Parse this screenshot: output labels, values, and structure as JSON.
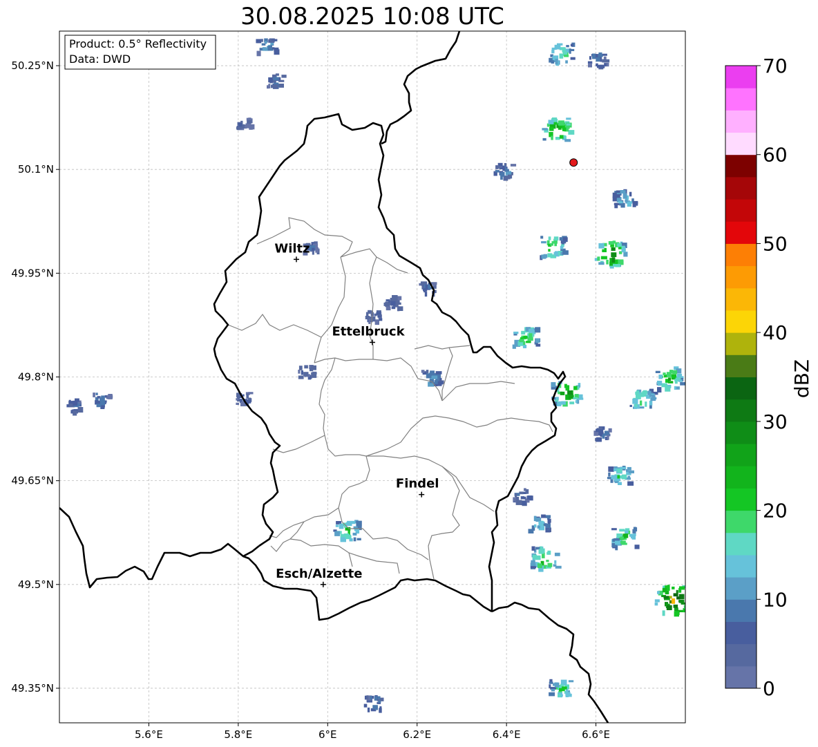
{
  "title": "30.08.2025 10:08 UTC",
  "info_box": {
    "line1": "Product: 0.5° Reflectivity",
    "line2": "Data: DWD"
  },
  "axes": {
    "x_ticks": [
      {
        "value": 5.6,
        "label": "5.6°E"
      },
      {
        "value": 5.8,
        "label": "5.8°E"
      },
      {
        "value": 6.0,
        "label": "6°E"
      },
      {
        "value": 6.2,
        "label": "6.2°E"
      },
      {
        "value": 6.4,
        "label": "6.4°E"
      },
      {
        "value": 6.6,
        "label": "6.6°E"
      }
    ],
    "y_ticks": [
      {
        "value": 50.25,
        "label": "50.25°N"
      },
      {
        "value": 50.1,
        "label": "50.1°N"
      },
      {
        "value": 49.95,
        "label": "49.95°N"
      },
      {
        "value": 49.8,
        "label": "49.8°N"
      },
      {
        "value": 49.65,
        "label": "49.65°N"
      },
      {
        "value": 49.5,
        "label": "49.5°N"
      },
      {
        "value": 49.35,
        "label": "49.35°N"
      }
    ],
    "lon_range": [
      5.4,
      6.8
    ],
    "lat_range": [
      49.3,
      50.3
    ],
    "grid": true
  },
  "cities": [
    {
      "name": "Wiltz",
      "lon": 5.93,
      "lat": 49.97
    },
    {
      "name": "Ettelbruck",
      "lon": 6.1,
      "lat": 49.85
    },
    {
      "name": "Findel",
      "lon": 6.21,
      "lat": 49.63
    },
    {
      "name": "Esch/Alzette",
      "lon": 5.99,
      "lat": 49.5
    }
  ],
  "radar_site": {
    "lon": 6.55,
    "lat": 50.11,
    "color": "#e31a1c"
  },
  "colorbar": {
    "label": "dBZ",
    "min": 0,
    "max": 70,
    "step": 2.5,
    "tick_labels": [
      "0",
      "10",
      "20",
      "30",
      "40",
      "50",
      "60",
      "70"
    ],
    "colors": [
      "#6674a8",
      "#56699f",
      "#485e9e",
      "#4a78ad",
      "#5b9fc7",
      "#66c2da",
      "#5fd8c4",
      "#3ed86a",
      "#14c624",
      "#12b41c",
      "#11a319",
      "#0f8d17",
      "#0e7a14",
      "#0b6512",
      "#4a7b16",
      "#afb30c",
      "#fcd506",
      "#fbb706",
      "#fd9b04",
      "#fd7f05",
      "#e3060a",
      "#c30608",
      "#a50608",
      "#7d0100",
      "#ffdbff",
      "#ffb0ff",
      "#ff73ff",
      "#eb3ef0"
    ]
  },
  "chart_data": {
    "type": "heatmap",
    "title": "30.08.2025 10:08 UTC",
    "colorbar_label": "dBZ",
    "value_range": [
      0,
      70
    ],
    "echo_cells": [
      {
        "lon": 5.43,
        "lat": 49.76,
        "dbz": 8
      },
      {
        "lon": 5.49,
        "lat": 49.77,
        "dbz": 10
      },
      {
        "lon": 5.81,
        "lat": 50.17,
        "dbz": 5
      },
      {
        "lon": 5.86,
        "lat": 50.28,
        "dbz": 12
      },
      {
        "lon": 5.88,
        "lat": 50.23,
        "dbz": 8
      },
      {
        "lon": 5.96,
        "lat": 49.99,
        "dbz": 5
      },
      {
        "lon": 5.95,
        "lat": 49.81,
        "dbz": 6
      },
      {
        "lon": 5.81,
        "lat": 49.77,
        "dbz": 6
      },
      {
        "lon": 6.1,
        "lat": 49.89,
        "dbz": 6
      },
      {
        "lon": 6.14,
        "lat": 49.91,
        "dbz": 6
      },
      {
        "lon": 6.04,
        "lat": 49.58,
        "dbz": 22
      },
      {
        "lon": 6.1,
        "lat": 49.33,
        "dbz": 10
      },
      {
        "lon": 6.22,
        "lat": 49.93,
        "dbz": 6
      },
      {
        "lon": 6.23,
        "lat": 49.8,
        "dbz": 12
      },
      {
        "lon": 6.52,
        "lat": 50.27,
        "dbz": 20
      },
      {
        "lon": 6.6,
        "lat": 50.26,
        "dbz": 10
      },
      {
        "lon": 6.51,
        "lat": 50.16,
        "dbz": 28
      },
      {
        "lon": 6.39,
        "lat": 50.1,
        "dbz": 10
      },
      {
        "lon": 6.66,
        "lat": 50.06,
        "dbz": 15
      },
      {
        "lon": 6.5,
        "lat": 49.99,
        "dbz": 22
      },
      {
        "lon": 6.63,
        "lat": 49.98,
        "dbz": 30
      },
      {
        "lon": 6.44,
        "lat": 49.86,
        "dbz": 22
      },
      {
        "lon": 6.53,
        "lat": 49.78,
        "dbz": 28
      },
      {
        "lon": 6.76,
        "lat": 49.8,
        "dbz": 25
      },
      {
        "lon": 6.7,
        "lat": 49.77,
        "dbz": 22
      },
      {
        "lon": 6.61,
        "lat": 49.72,
        "dbz": 8
      },
      {
        "lon": 6.65,
        "lat": 49.66,
        "dbz": 18
      },
      {
        "lon": 6.43,
        "lat": 49.63,
        "dbz": 8
      },
      {
        "lon": 6.47,
        "lat": 49.59,
        "dbz": 15
      },
      {
        "lon": 6.66,
        "lat": 49.57,
        "dbz": 22
      },
      {
        "lon": 6.48,
        "lat": 49.54,
        "dbz": 25
      },
      {
        "lon": 6.77,
        "lat": 49.48,
        "dbz": 38
      },
      {
        "lon": 6.52,
        "lat": 49.35,
        "dbz": 20
      }
    ]
  }
}
